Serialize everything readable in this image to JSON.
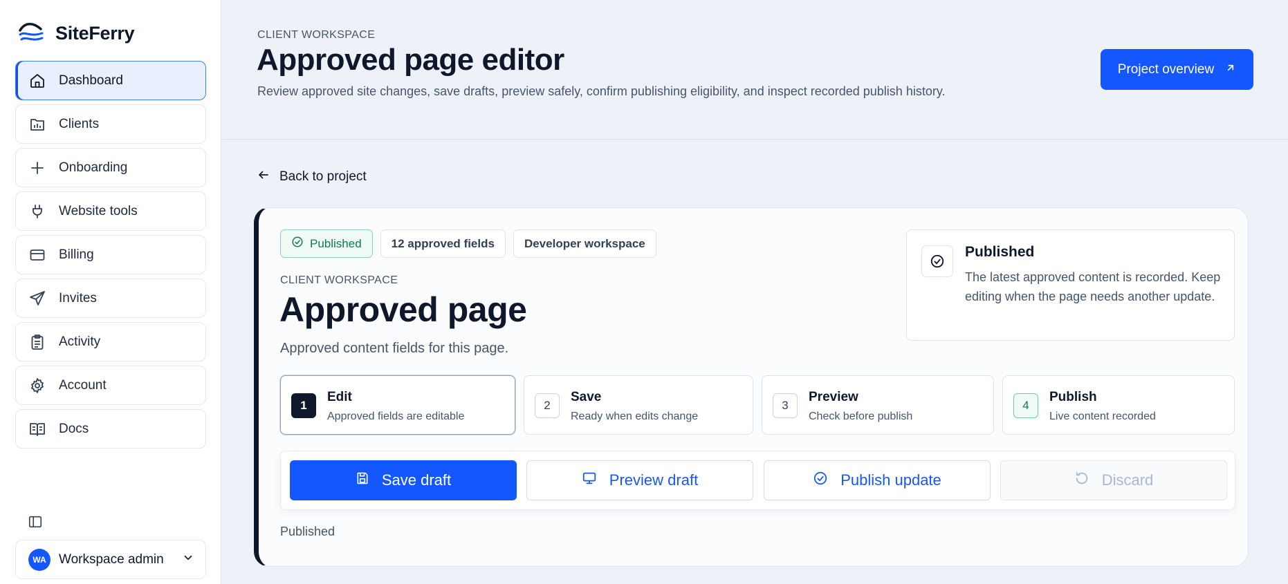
{
  "brand": {
    "name": "SiteFerry"
  },
  "sidebar": {
    "items": [
      {
        "label": "Dashboard",
        "icon": "home-icon",
        "active": true
      },
      {
        "label": "Clients",
        "icon": "chart-folder-icon"
      },
      {
        "label": "Onboarding",
        "icon": "plus-icon"
      },
      {
        "label": "Website tools",
        "icon": "plug-icon"
      },
      {
        "label": "Billing",
        "icon": "card-icon"
      },
      {
        "label": "Invites",
        "icon": "send-icon"
      },
      {
        "label": "Activity",
        "icon": "clipboard-icon"
      },
      {
        "label": "Account",
        "icon": "gear-icon"
      },
      {
        "label": "Docs",
        "icon": "book-icon"
      }
    ],
    "user": {
      "initials": "WA",
      "name": "Workspace admin"
    }
  },
  "header": {
    "eyebrow": "CLIENT WORKSPACE",
    "title": "Approved page editor",
    "description": "Review approved site changes, save drafts, preview safely, confirm publishing eligibility, and inspect recorded publish history.",
    "overview_button": "Project overview"
  },
  "back_link": "Back to project",
  "card": {
    "chips": [
      "Published",
      "12 approved fields",
      "Developer workspace"
    ],
    "eyebrow": "CLIENT WORKSPACE",
    "title": "Approved page",
    "description": "Approved content fields for this page.",
    "status": {
      "title": "Published",
      "text": "The latest approved content is recorded. Keep editing when the page needs another update."
    },
    "steps": [
      {
        "num": "1",
        "title": "Edit",
        "sub": "Approved fields are editable"
      },
      {
        "num": "2",
        "title": "Save",
        "sub": "Ready when edits change"
      },
      {
        "num": "3",
        "title": "Preview",
        "sub": "Check before publish"
      },
      {
        "num": "4",
        "title": "Publish",
        "sub": "Live content recorded"
      }
    ],
    "actions": {
      "save": "Save draft",
      "preview": "Preview draft",
      "publish": "Publish update",
      "discard": "Discard"
    },
    "footer_status": "Published"
  },
  "colors": {
    "accent": "#1557ff",
    "success": "#0f7a52",
    "ink": "#0f172a"
  }
}
